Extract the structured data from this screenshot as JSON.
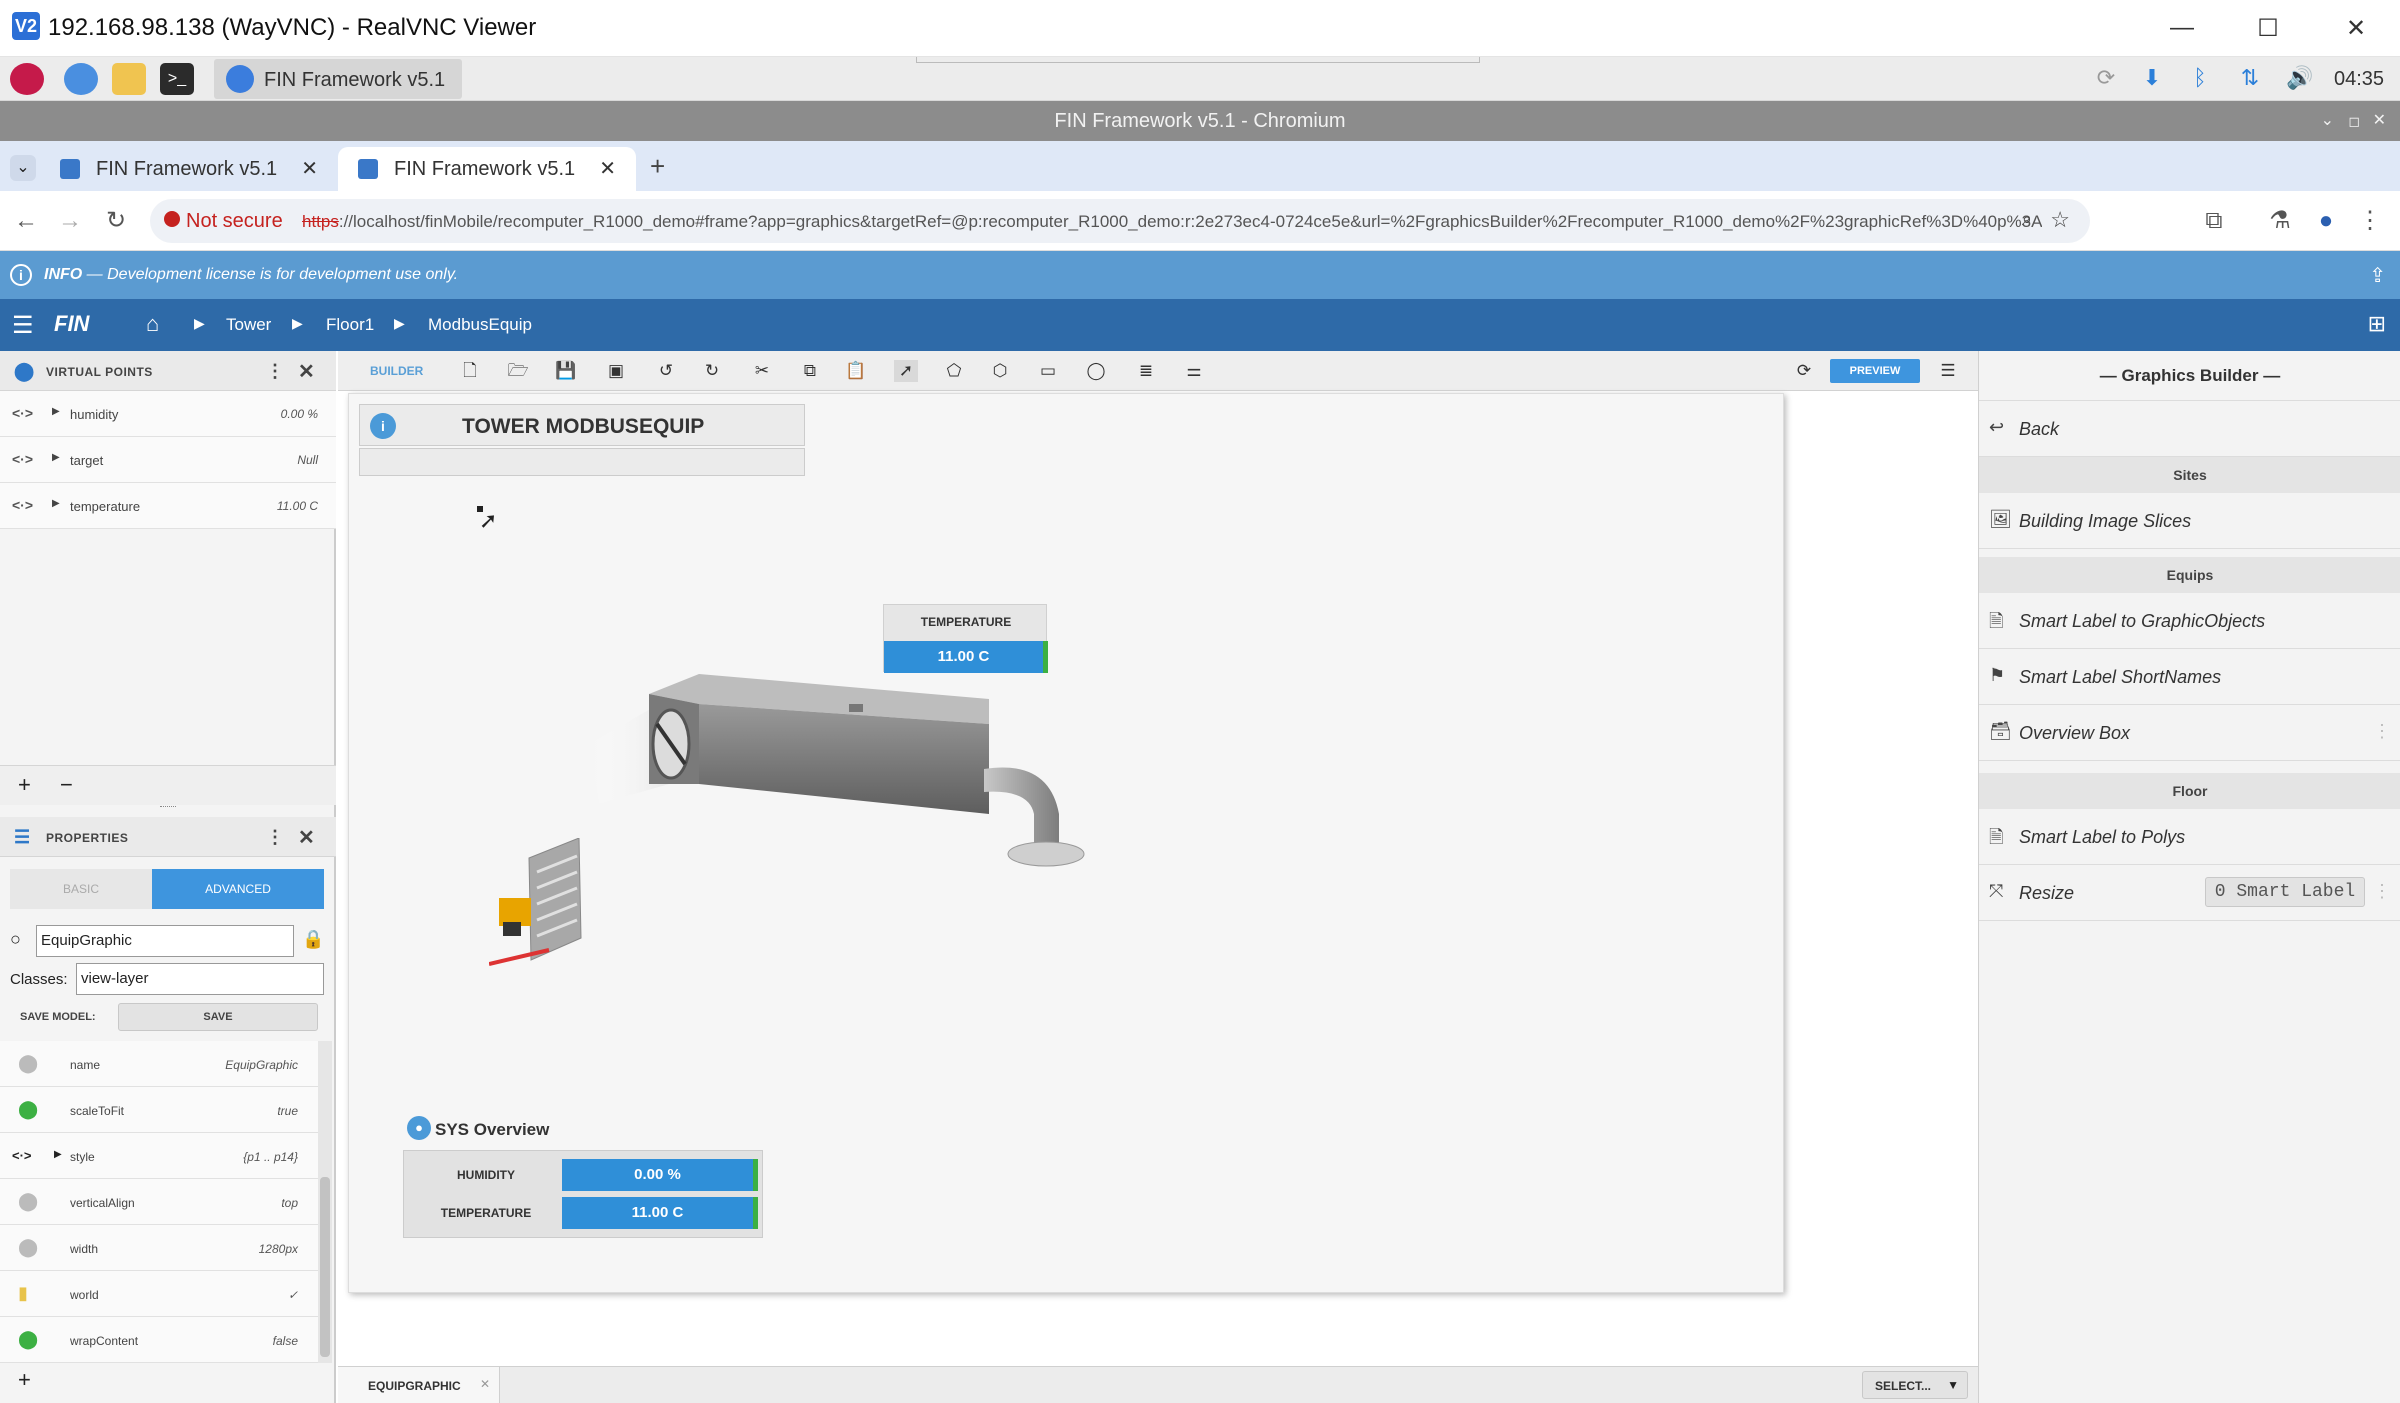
{
  "vnc": {
    "title": "192.168.98.138 (WayVNC) - RealVNC Viewer"
  },
  "taskbar": {
    "app_label": "FIN Framework v5.1 ...",
    "clock": "04:35"
  },
  "chrome": {
    "window_title": "FIN Framework v5.1 - Chromium",
    "tabs": [
      {
        "label": "FIN Framework v5.1"
      },
      {
        "label": "FIN Framework v5.1"
      }
    ],
    "not_secure": "Not secure",
    "url_proto": "https",
    "url_rest": "://localhost/finMobile/recomputer_R1000_demo#frame?app=graphics&targetRef=@p:recomputer_R1000_demo:r:2e273ec4-0724ce5e&url=%2FgraphicsBuilder%2Frecomputer_R1000_demo%2F%23graphicRef%3D%40p%3Ar..."
  },
  "info": {
    "label": "INFO",
    "message": " — Development license is for development use only."
  },
  "nav": {
    "logo": "FIN",
    "crumbs": [
      "Tower",
      "Floor1",
      "ModbusEquip"
    ]
  },
  "virtual_points": {
    "title": "VIRTUAL POINTS",
    "rows": [
      {
        "name": "humidity",
        "value": "0.00 %"
      },
      {
        "name": "target",
        "value": "Null"
      },
      {
        "name": "temperature",
        "value": "11.00 C"
      }
    ]
  },
  "properties": {
    "title": "PROPERTIES",
    "tab_basic": "BASIC",
    "tab_advanced": "ADVANCED",
    "name_value": "EquipGraphic",
    "classes_label": "Classes:",
    "classes_value": "view-layer",
    "save_model_label": "SAVE MODEL:",
    "save_label": "SAVE",
    "rows": [
      {
        "name": "name",
        "value": "EquipGraphic"
      },
      {
        "name": "scaleToFit",
        "value": "true"
      },
      {
        "name": "style",
        "value": "{p1 .. p14}"
      },
      {
        "name": "verticalAlign",
        "value": "top"
      },
      {
        "name": "width",
        "value": "1280px"
      },
      {
        "name": "world",
        "value": "✓"
      },
      {
        "name": "wrapContent",
        "value": "false"
      }
    ]
  },
  "toolbar": {
    "builder_label": "BUILDER",
    "preview_label": "PREVIEW"
  },
  "canvas": {
    "header_title": "TOWER MODBUSEQUIP",
    "temp_label": "TEMPERATURE",
    "temp_value": "11.00 C",
    "sys_title": "SYS Overview",
    "sys_rows": [
      {
        "label": "HUMIDITY",
        "value": "0.00 %"
      },
      {
        "label": "TEMPERATURE",
        "value": "11.00 C"
      }
    ]
  },
  "bottom": {
    "tab_label": "EQUIPGRAPHIC",
    "select_label": "SELECT..."
  },
  "graphics_builder": {
    "title": "— Graphics Builder —",
    "back_label": "Back",
    "sections": [
      {
        "header": "Sites",
        "items": [
          "Building Image Slices"
        ]
      },
      {
        "header": "Equips",
        "items": [
          "Smart Label to GraphicObjects",
          "Smart Label ShortNames",
          "Overview Box"
        ]
      },
      {
        "header": "Floor",
        "items": [
          "Smart Label to Polys",
          "Resize"
        ]
      }
    ],
    "resize_badge": "0 Smart Label"
  },
  "colors": {
    "accent": "#2e6aa8",
    "info": "#5b9bd1",
    "value_blue": "#2f8fd8",
    "ok_green": "#3cb043"
  }
}
